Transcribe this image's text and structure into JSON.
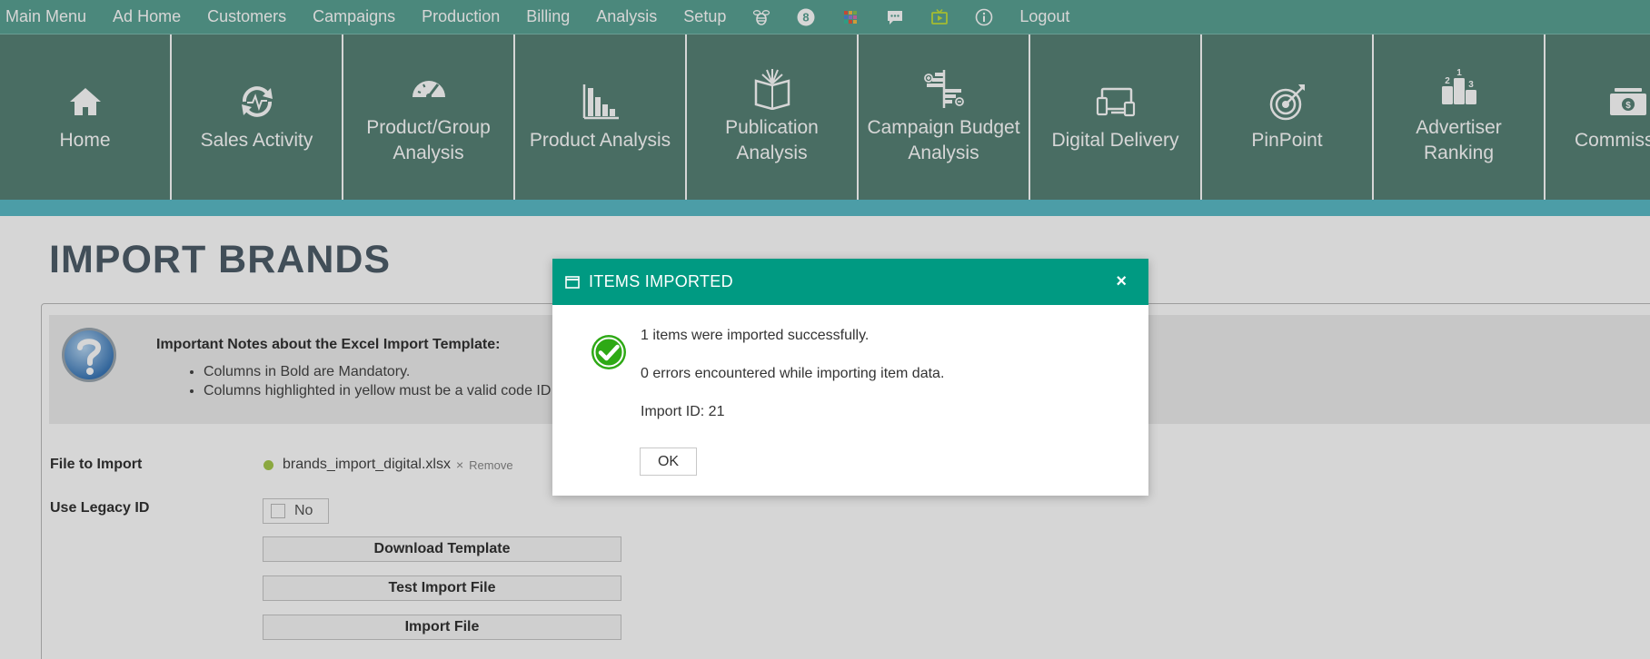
{
  "topbar": {
    "items": [
      "Main Menu",
      "Ad Home",
      "Customers",
      "Campaigns",
      "Production",
      "Billing",
      "Analysis",
      "Setup"
    ],
    "icons": [
      "bee-icon",
      "badge-8-icon",
      "grid-icon",
      "chat-icon",
      "tv-icon",
      "info-icon"
    ],
    "badge_number": "8",
    "logout": "Logout"
  },
  "tiles": [
    {
      "label": "Home",
      "icon": "home-icon"
    },
    {
      "label": "Sales Activity",
      "icon": "sales-activity-icon"
    },
    {
      "label": "Product/Group\nAnalysis",
      "icon": "gauge-icon"
    },
    {
      "label": "Product Analysis",
      "icon": "bar-chart-icon"
    },
    {
      "label": "Publication\nAnalysis",
      "icon": "book-icon"
    },
    {
      "label": "Campaign Budget\nAnalysis",
      "icon": "budget-icon"
    },
    {
      "label": "Digital Delivery",
      "icon": "devices-icon"
    },
    {
      "label": "PinPoint",
      "icon": "target-icon"
    },
    {
      "label": "Advertiser\nRanking",
      "icon": "podium-icon"
    },
    {
      "label": "Commissi",
      "icon": "money-icon"
    }
  ],
  "page": {
    "title": "IMPORT BRANDS",
    "notes_title": "Important Notes about the Excel Import Template:",
    "notes": [
      "Columns in Bold are Mandatory.",
      "Columns highlighted in yellow must be a valid code ID i"
    ],
    "file_label": "File to Import",
    "file_name": "brands_import_digital.xlsx",
    "remove_x": "×",
    "remove": "Remove",
    "legacy_label": "Use Legacy ID",
    "legacy_value": "No",
    "download_template": "Download Template",
    "test_import": "Test Import File",
    "import_file": "Import File"
  },
  "dialog": {
    "title": "ITEMS IMPORTED",
    "close": "×",
    "line1": "1 items were imported successfully.",
    "line2": "0 errors encountered while importing item data.",
    "line3": "Import ID: 21",
    "ok": "OK"
  },
  "colors": {
    "topbar": "#5aa294",
    "tiles": "#578277",
    "stripe": "#5bbcc8",
    "dialog_header": "#009a82",
    "success": "#2ea915"
  }
}
